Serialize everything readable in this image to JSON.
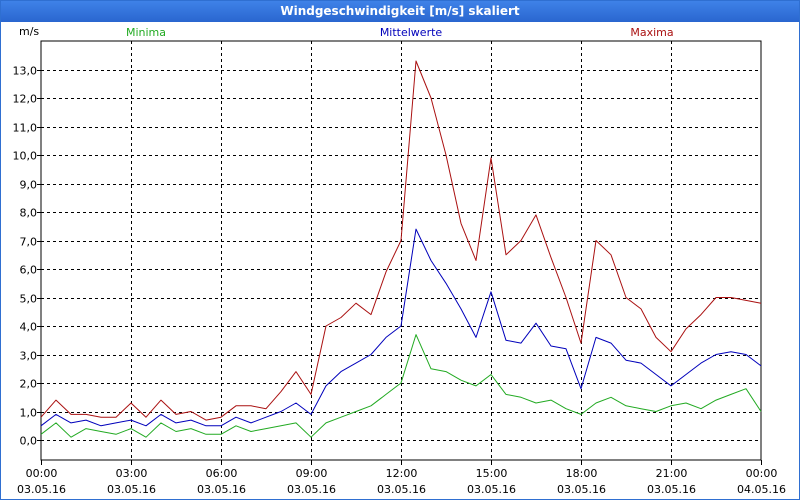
{
  "window": {
    "title": "Windgeschwindigkeit [m/s] skaliert"
  },
  "colors": {
    "minima": "#22aa22",
    "mittelwerte": "#0000bb",
    "maxima": "#aa1111",
    "grid": "#000000"
  },
  "chart_data": {
    "type": "line",
    "title": "Windgeschwindigkeit [m/s] skaliert",
    "ylabel": "m/s",
    "ylim": [
      -0.7,
      14.0
    ],
    "xlim": [
      0,
      24
    ],
    "yticks": [
      0.0,
      1.0,
      2.0,
      3.0,
      4.0,
      5.0,
      6.0,
      7.0,
      8.0,
      9.0,
      10.0,
      11.0,
      12.0,
      13.0
    ],
    "ytick_labels": [
      "0,0",
      "1,0",
      "2,0",
      "3,0",
      "4,0",
      "5,0",
      "6,0",
      "7,0",
      "8,0",
      "9,0",
      "10,0",
      "11,0",
      "12,0",
      "13,0"
    ],
    "xticks": [
      {
        "hour": 0,
        "time": "00:00",
        "date": "03.05.16"
      },
      {
        "hour": 3,
        "time": "03:00",
        "date": "03.05.16"
      },
      {
        "hour": 6,
        "time": "06:00",
        "date": "03.05.16"
      },
      {
        "hour": 9,
        "time": "09:00",
        "date": "03.05.16"
      },
      {
        "hour": 12,
        "time": "12:00",
        "date": "03.05.16"
      },
      {
        "hour": 15,
        "time": "15:00",
        "date": "03.05.16"
      },
      {
        "hour": 18,
        "time": "18:00",
        "date": "03.05.16"
      },
      {
        "hour": 21,
        "time": "21:00",
        "date": "03.05.16"
      },
      {
        "hour": 24,
        "time": "00:00",
        "date": "04.05.16"
      }
    ],
    "grid": true,
    "grid_style": "dashed",
    "x": [
      0.0,
      0.5,
      1.0,
      1.5,
      2.0,
      2.5,
      3.0,
      3.5,
      4.0,
      4.5,
      5.0,
      5.5,
      6.0,
      6.5,
      7.0,
      7.5,
      8.0,
      8.5,
      9.0,
      9.5,
      10.0,
      10.5,
      11.0,
      11.5,
      12.0,
      12.5,
      13.0,
      13.5,
      14.0,
      14.5,
      15.0,
      15.5,
      16.0,
      16.5,
      17.0,
      17.5,
      18.0,
      18.5,
      19.0,
      19.5,
      20.0,
      20.5,
      21.0,
      21.5,
      22.0,
      22.5,
      23.0,
      23.5,
      24.0
    ],
    "series": [
      {
        "name": "Minima",
        "color": "#22aa22",
        "legend_position": "left",
        "values": [
          0.2,
          0.6,
          0.1,
          0.4,
          0.3,
          0.2,
          0.4,
          0.1,
          0.6,
          0.3,
          0.4,
          0.2,
          0.2,
          0.5,
          0.3,
          0.4,
          0.5,
          0.6,
          0.1,
          0.6,
          0.8,
          1.0,
          1.2,
          1.6,
          2.0,
          3.7,
          2.5,
          2.4,
          2.1,
          1.9,
          2.3,
          1.6,
          1.5,
          1.3,
          1.4,
          1.1,
          0.9,
          1.3,
          1.5,
          1.2,
          1.1,
          1.0,
          1.2,
          1.3,
          1.1,
          1.4,
          1.6,
          1.8,
          1.0
        ]
      },
      {
        "name": "Mittelwerte",
        "color": "#0000bb",
        "legend_position": "center",
        "values": [
          0.5,
          0.9,
          0.6,
          0.7,
          0.5,
          0.6,
          0.7,
          0.5,
          0.9,
          0.6,
          0.7,
          0.5,
          0.5,
          0.8,
          0.6,
          0.8,
          1.0,
          1.3,
          0.9,
          1.9,
          2.4,
          2.7,
          3.0,
          3.6,
          4.0,
          7.4,
          6.3,
          5.5,
          4.6,
          3.6,
          5.2,
          3.5,
          3.4,
          4.1,
          3.3,
          3.2,
          1.8,
          3.6,
          3.4,
          2.8,
          2.7,
          2.3,
          1.9,
          2.3,
          2.7,
          3.0,
          3.1,
          3.0,
          2.6
        ]
      },
      {
        "name": "Maxima",
        "color": "#aa1111",
        "legend_position": "right",
        "values": [
          0.8,
          1.4,
          0.9,
          0.9,
          0.8,
          0.8,
          1.3,
          0.8,
          1.4,
          0.9,
          1.0,
          0.7,
          0.8,
          1.2,
          1.2,
          1.1,
          1.7,
          2.4,
          1.6,
          4.0,
          4.3,
          4.8,
          4.4,
          5.9,
          7.0,
          13.3,
          12.0,
          10.0,
          7.6,
          6.3,
          9.9,
          6.5,
          7.0,
          7.9,
          6.4,
          5.0,
          3.4,
          7.0,
          6.5,
          5.0,
          4.6,
          3.6,
          3.1,
          3.9,
          4.4,
          5.0,
          5.0,
          4.9,
          4.8
        ]
      }
    ]
  }
}
